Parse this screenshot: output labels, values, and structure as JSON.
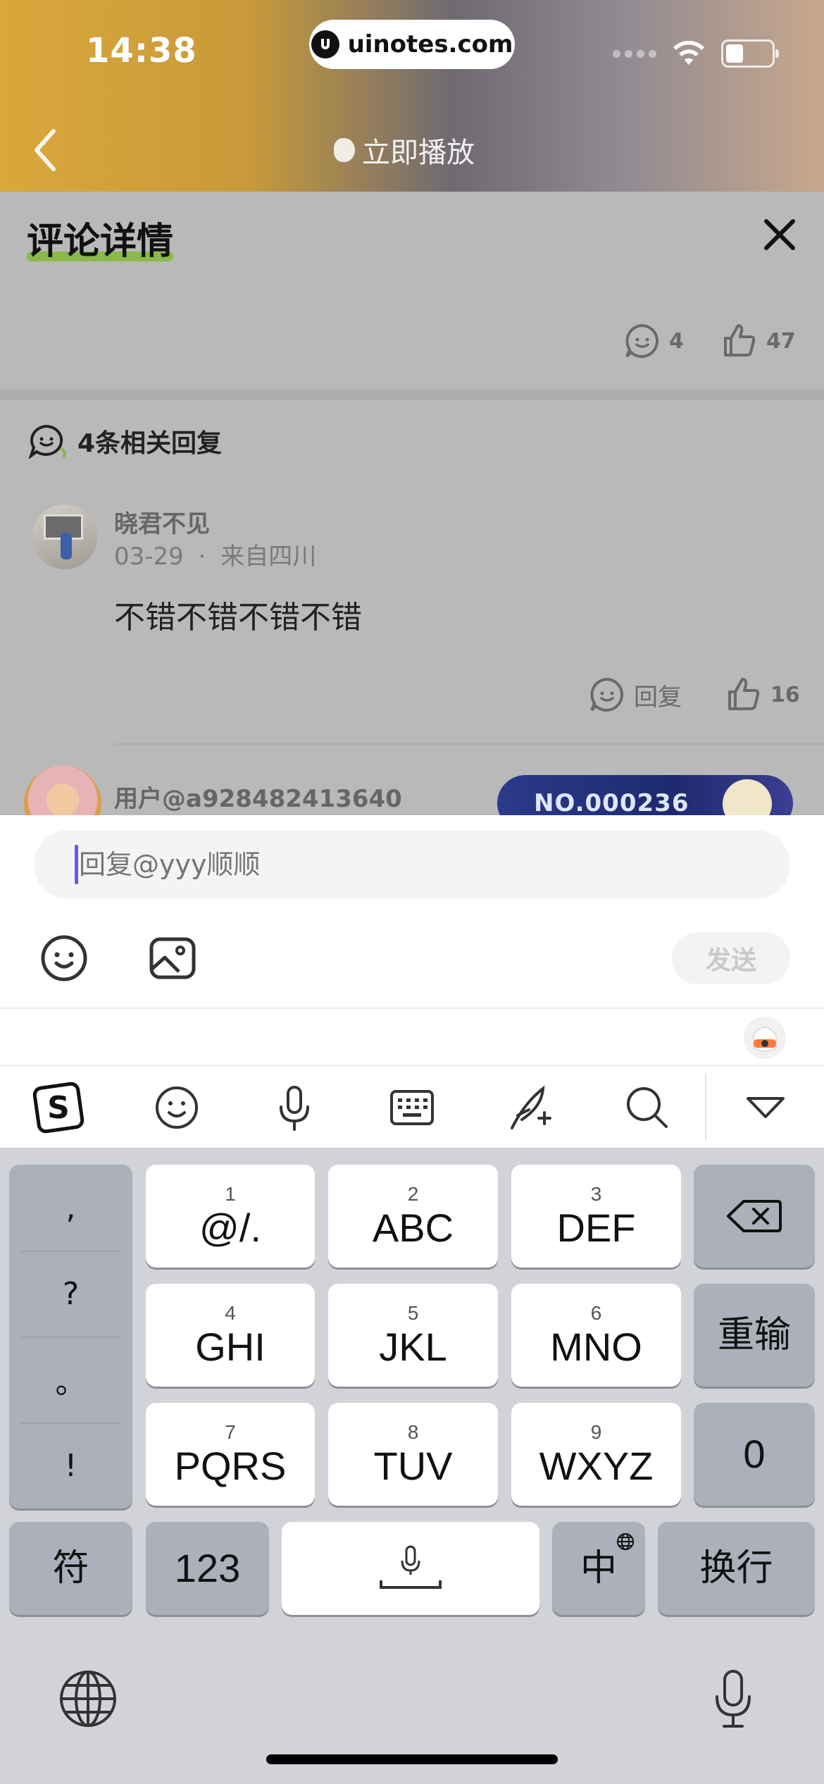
{
  "status_bar": {
    "time": "14:38",
    "url": "uinotes.com"
  },
  "player": {
    "play_label": "立即播放"
  },
  "sheet": {
    "title": "评论详情",
    "comment_count": "4",
    "like_count": "47",
    "replies_heading": "4条相关回复",
    "replies": [
      {
        "username": "晓君不见",
        "date": "03-29",
        "location": "来自四川",
        "text": "不错不错不错不错",
        "reply_label": "回复",
        "likes": "16"
      },
      {
        "username": "用户@a928482413640",
        "badge": "NO.000236"
      }
    ],
    "meta_separator": "·"
  },
  "composer": {
    "placeholder": "回复@yyy顺顺",
    "send_label": "发送"
  },
  "keyboard": {
    "punct": [
      ",",
      "?",
      "。",
      "!"
    ],
    "keys": [
      {
        "num": "1",
        "label": "@/."
      },
      {
        "num": "2",
        "label": "ABC"
      },
      {
        "num": "3",
        "label": "DEF"
      },
      {
        "num": "4",
        "label": "GHI"
      },
      {
        "num": "5",
        "label": "JKL"
      },
      {
        "num": "6",
        "label": "MNO"
      },
      {
        "num": "7",
        "label": "PQRS"
      },
      {
        "num": "8",
        "label": "TUV"
      },
      {
        "num": "9",
        "label": "WXYZ"
      }
    ],
    "reenter": "重输",
    "zero": "0",
    "symbols": "符",
    "numbers": "123",
    "lang": "中",
    "newline": "换行"
  }
}
